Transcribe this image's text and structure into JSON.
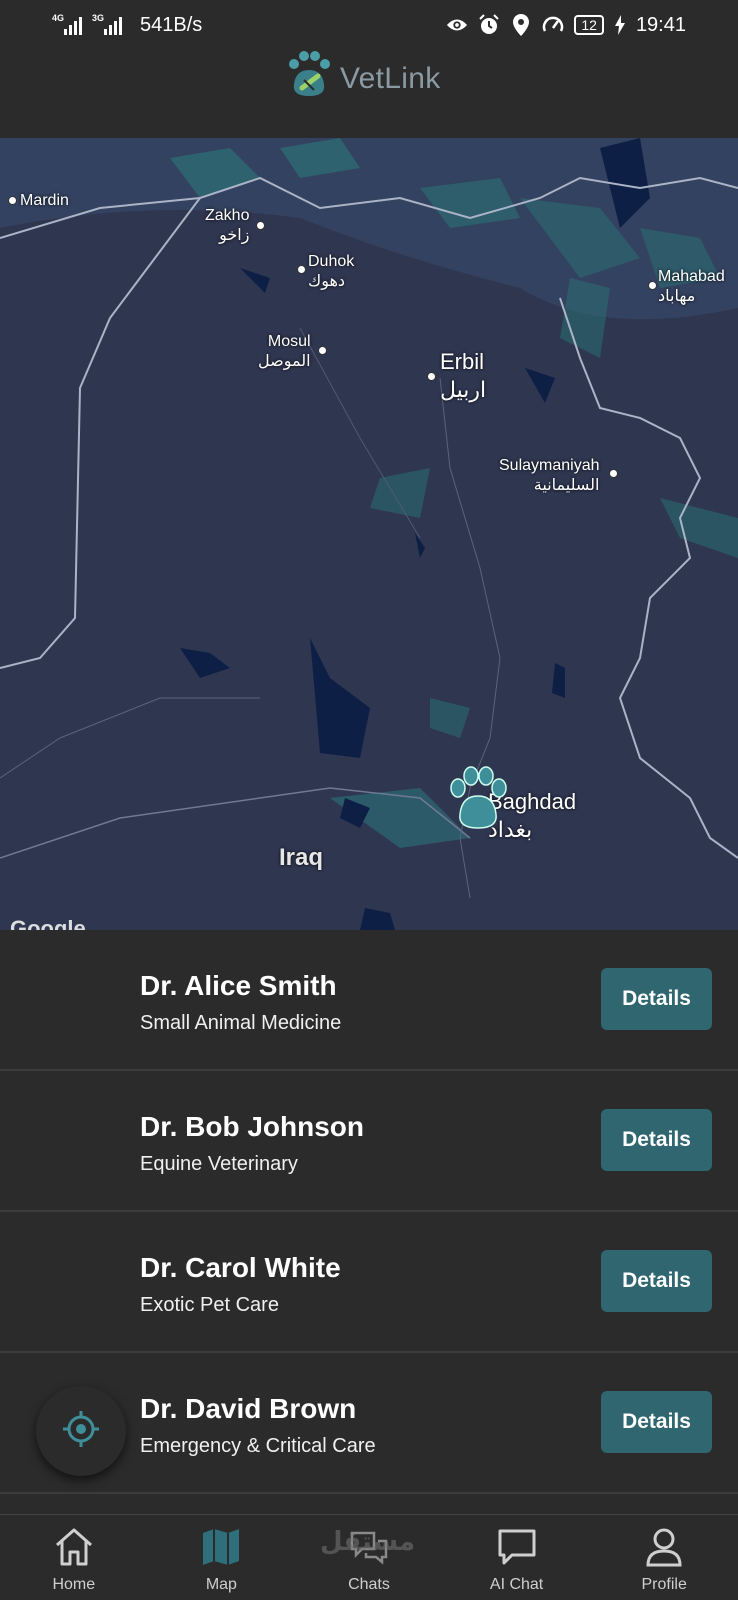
{
  "status_bar": {
    "network_1": "4G",
    "network_2": "3G",
    "speed": "541B/s",
    "battery": "12",
    "time": "19:41",
    "icons": [
      "eye-icon",
      "alarm-icon",
      "location-icon",
      "speedometer-icon",
      "battery-icon",
      "charging-icon"
    ]
  },
  "header": {
    "app_name": "VetLink",
    "logo_icon": "paw-link-icon"
  },
  "map": {
    "country_label": "Iraq",
    "cities": [
      {
        "name": "Mardin",
        "ar": ""
      },
      {
        "name": "Zakho",
        "ar": "زاخو"
      },
      {
        "name": "Duhok",
        "ar": "دهوك"
      },
      {
        "name": "Mosul",
        "ar": "الموصل"
      },
      {
        "name": "Erbil",
        "ar": "اربيل"
      },
      {
        "name": "Mahabad",
        "ar": "مهاباد"
      },
      {
        "name": "Sulaymaniyah",
        "ar": "السليمانية"
      },
      {
        "name": "Baghdad",
        "ar": "بغداد"
      }
    ],
    "attribution": "Google",
    "marker_icon": "paw-marker-icon"
  },
  "vets": [
    {
      "name": "Dr. Alice Smith",
      "specialty": "Small Animal Medicine",
      "button": "Details"
    },
    {
      "name": "Dr. Bob Johnson",
      "specialty": "Equine Veterinary",
      "button": "Details"
    },
    {
      "name": "Dr. Carol White",
      "specialty": "Exotic Pet Care",
      "button": "Details"
    },
    {
      "name": "Dr. David Brown",
      "specialty": "Emergency & Critical Care",
      "button": "Details"
    }
  ],
  "nav": {
    "items": [
      {
        "label": "Home",
        "icon": "home-icon"
      },
      {
        "label": "Map",
        "icon": "map-icon"
      },
      {
        "label": "Chats",
        "icon": "chat-bubbles-icon"
      },
      {
        "label": "AI Chat",
        "icon": "message-icon"
      },
      {
        "label": "Profile",
        "icon": "person-icon"
      }
    ],
    "active": "Map"
  },
  "watermark": "مستقل",
  "colors": {
    "background": "#2b2b2b",
    "map_bg": "#2f3650",
    "accent": "#2f6670",
    "active_nav": "#2e6f7b"
  }
}
